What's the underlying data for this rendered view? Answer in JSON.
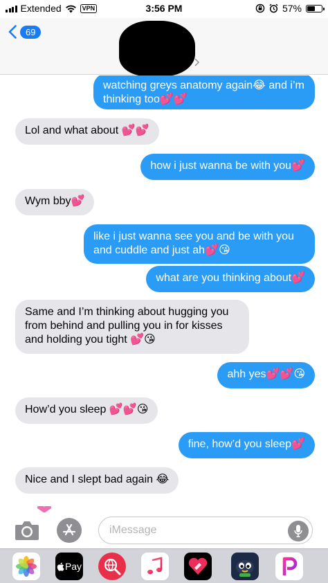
{
  "status_bar": {
    "carrier": "Extended",
    "vpn": "VPN",
    "time": "3:56 PM",
    "battery": "57%",
    "battery_level": 0.57
  },
  "header": {
    "back_count": "69"
  },
  "messages": [
    {
      "side": "sent",
      "text": "watching greys anatomy again😂 and i’m thinking too💕💕"
    },
    {
      "side": "received",
      "text": "Lol and what about 💕💕"
    },
    {
      "side": "sent",
      "text": "how i just wanna be with you💕"
    },
    {
      "side": "received",
      "text": "Wym bby💕"
    },
    {
      "side": "sent",
      "text": "like i just wanna see you and be with you and cuddle and just ah💕😘"
    },
    {
      "side": "sent",
      "text": "what are you thinking about💕"
    },
    {
      "side": "received",
      "text": "Same and I’m thinking about hugging you from behind and pulling you in for kisses and holding you tight 💕😘"
    },
    {
      "side": "sent",
      "text": "ahh yes💕💕😘"
    },
    {
      "side": "received",
      "text": "How’d you sleep 💕💕😘"
    },
    {
      "side": "sent",
      "text": "fine, how’d you sleep💕"
    },
    {
      "side": "received",
      "text": "Nice and I slept bad again 😂"
    }
  ],
  "compose": {
    "placeholder": "iMessage"
  },
  "app_drawer": [
    {
      "name": "photos",
      "label": ""
    },
    {
      "name": "apple-pay",
      "label": "Pay"
    },
    {
      "name": "search-images",
      "label": ""
    },
    {
      "name": "music",
      "label": ""
    },
    {
      "name": "digital-touch",
      "label": ""
    },
    {
      "name": "game-app",
      "label": ""
    },
    {
      "name": "picsart",
      "label": ""
    }
  ]
}
